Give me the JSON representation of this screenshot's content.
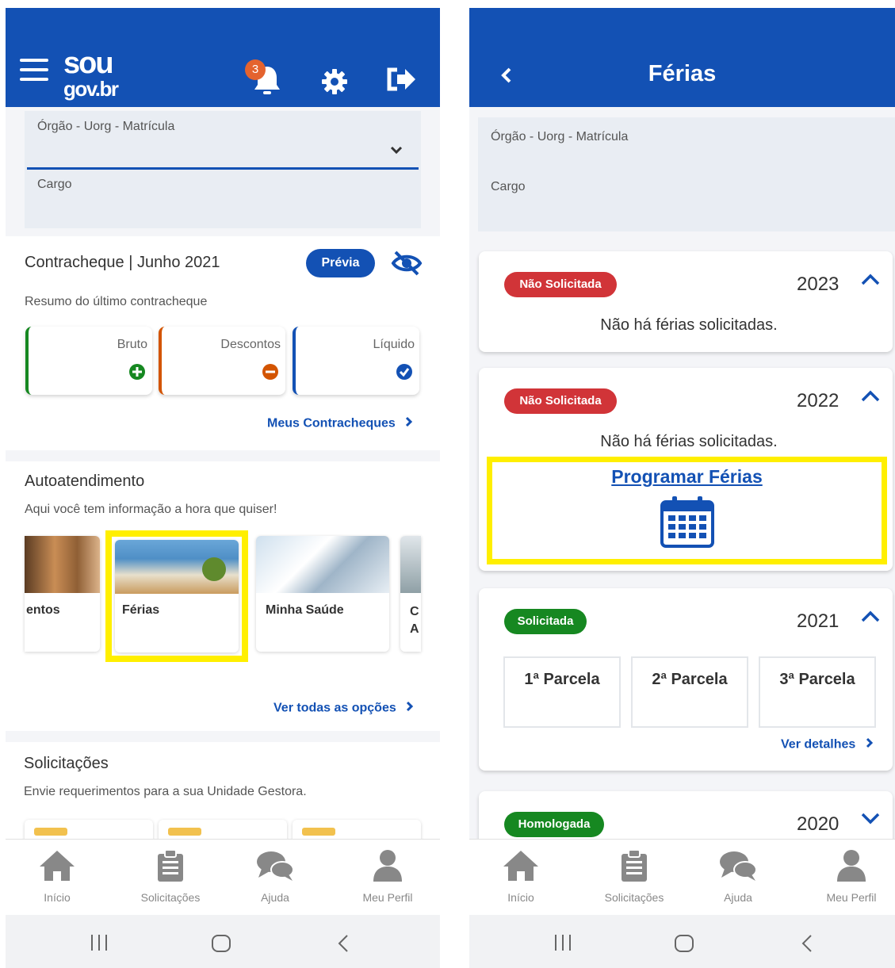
{
  "left": {
    "header": {
      "logo_top": "sou",
      "logo_bottom": "gov.br",
      "notification_count": "3"
    },
    "profile": {
      "org_label": "Órgão - Uorg - Matrícula",
      "cargo_label": "Cargo"
    },
    "payslip": {
      "title": "Contracheque | Junho 2021",
      "preview_button": "Prévia",
      "subtitle": "Resumo do último contracheque",
      "cards": [
        {
          "label": "Bruto",
          "icon": "plus-circle-icon",
          "color": "#168821"
        },
        {
          "label": "Descontos",
          "icon": "minus-circle-icon",
          "color": "#d35400"
        },
        {
          "label": "Líquido",
          "icon": "check-circle-icon",
          "color": "#1351b4"
        }
      ],
      "link": "Meus Contracheques"
    },
    "self_service": {
      "title": "Autoatendimento",
      "subtitle": "Aqui você tem informação a hora que quiser!",
      "items": [
        {
          "label": "entos"
        },
        {
          "label": "Férias"
        },
        {
          "label": "Minha Saúde"
        },
        {
          "label": "C A"
        }
      ],
      "link": "Ver todas as opções"
    },
    "requests": {
      "title": "Solicitações",
      "subtitle": "Envie requerimentos para a sua Unidade Gestora."
    }
  },
  "right": {
    "header": {
      "title": "Férias"
    },
    "profile": {
      "org_label": "Órgão - Uorg - Matrícula",
      "cargo_label": "Cargo"
    },
    "vacations": [
      {
        "status": "Não Solicitada",
        "year": "2023",
        "message": "Não há férias solicitadas."
      },
      {
        "status": "Não Solicitada",
        "year": "2022",
        "message": "Não há férias solicitadas.",
        "action": "Programar Férias"
      },
      {
        "status": "Solicitada",
        "year": "2021",
        "parcels": [
          "1ª Parcela",
          "2ª Parcela",
          "3ª Parcela"
        ],
        "link": "Ver detalhes"
      },
      {
        "status": "Homologada",
        "year": "2020"
      }
    ]
  },
  "bottom_nav": {
    "items": [
      {
        "label": "Início",
        "icon": "home-icon"
      },
      {
        "label": "Solicitações",
        "icon": "clipboard-icon"
      },
      {
        "label": "Ajuda",
        "icon": "chat-icon"
      },
      {
        "label": "Meu Perfil",
        "icon": "user-icon"
      }
    ]
  },
  "colors": {
    "primary": "#1351b4",
    "highlight": "#ffef00",
    "status_red": "#d13438",
    "status_green": "#168821"
  }
}
